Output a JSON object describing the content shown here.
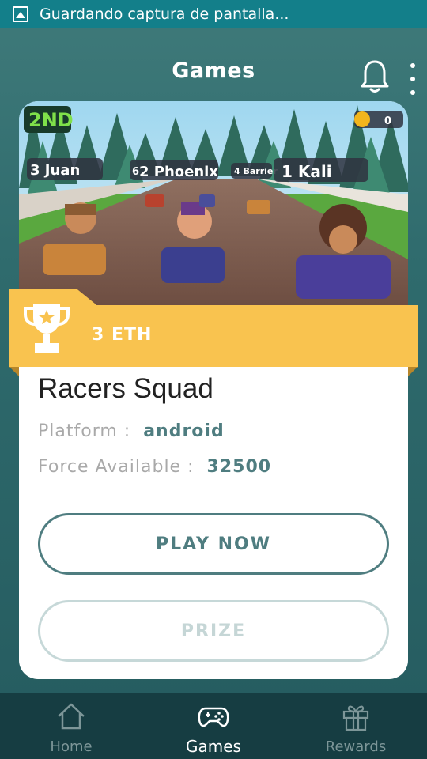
{
  "status_bar": {
    "text": "Guardando captura de pantalla...",
    "icon": "screenshot-icon"
  },
  "app_bar": {
    "title": "Games",
    "notification_icon": "bell-icon",
    "menu_icon": "more-vert-icon"
  },
  "game": {
    "name": "Racers Squad",
    "prize": "3 ETH",
    "platform_label": "Platform :",
    "platform": "android",
    "force_label": "Force Available :",
    "force": "32500",
    "hero_overlay": {
      "position": "2ND",
      "racers": [
        "3 Juan",
        "6",
        "2 Phoenix",
        "4 Barrier",
        "1 Kali"
      ],
      "coins": "0"
    }
  },
  "buttons": {
    "play": "PLAY NOW",
    "prize": "PRIZE"
  },
  "bottom_nav": {
    "items": [
      {
        "label": "Home",
        "icon": "home-icon",
        "active": false
      },
      {
        "label": "Games",
        "icon": "gamepad-icon",
        "active": true
      },
      {
        "label": "Rewards",
        "icon": "gift-icon",
        "active": false
      }
    ]
  },
  "colors": {
    "accent": "#4f7d80",
    "banner": "#f9c34f",
    "status_bar": "#137f8a",
    "nav": "#163d42"
  }
}
